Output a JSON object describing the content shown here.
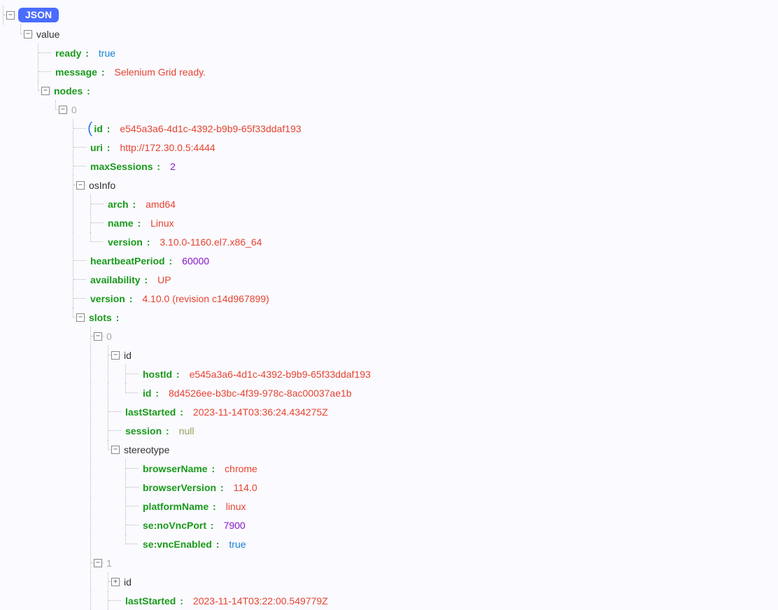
{
  "root_badge": "JSON",
  "value": {
    "ready": "true",
    "message": "Selenium Grid ready.",
    "nodes_label": "nodes",
    "nodes": [
      {
        "idx": "0",
        "id": "e545a3a6-4d1c-4392-b9b9-65f33ddaf193",
        "uri": "http://172.30.0.5:4444",
        "maxSessions": "2",
        "osInfo_label": "osInfo",
        "osInfo": {
          "arch": "amd64",
          "name": "Linux",
          "version": "3.10.0-1160.el7.x86_64"
        },
        "heartbeatPeriod": "60000",
        "availability": "UP",
        "version": "4.10.0 (revision c14d967899)",
        "slots_label": "slots",
        "slots": [
          {
            "idx": "0",
            "id_label": "id",
            "id": {
              "hostId": "e545a3a6-4d1c-4392-b9b9-65f33ddaf193",
              "id": "8d4526ee-b3bc-4f39-978c-8ac00037ae1b"
            },
            "lastStarted": "2023-11-14T03:36:24.434275Z",
            "session": "null",
            "stereotype_label": "stereotype",
            "stereotype": {
              "browserName": "chrome",
              "browserVersion": "114.0",
              "platformName": "linux",
              "seNoVncPort": "7900",
              "seVncEnabled": "true"
            }
          },
          {
            "idx": "1",
            "id_label": "id",
            "lastStarted": "2023-11-14T03:22:00.549779Z"
          }
        ]
      }
    ]
  }
}
